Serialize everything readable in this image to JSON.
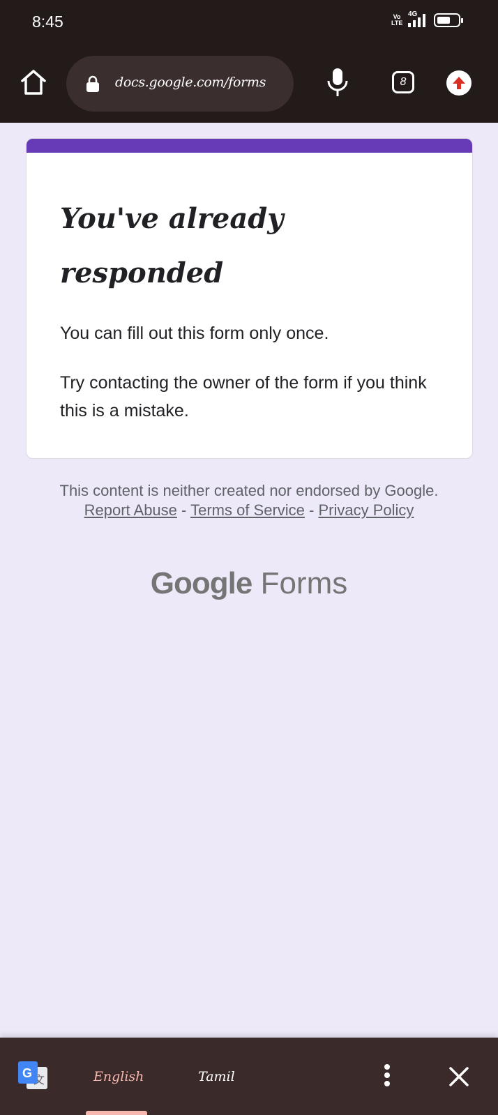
{
  "status_bar": {
    "time": "8:45",
    "volte_top": "Vo",
    "volte_bottom": "LTE",
    "network": "4G"
  },
  "browser": {
    "url": "docs.google.com/forms",
    "tab_count": "8"
  },
  "form": {
    "accent_color": "#673ab7",
    "title": "You've already responded",
    "message_once": "You can fill out this form only once.",
    "message_contact": "Try contacting the owner of the form if you think this is a mistake."
  },
  "footer": {
    "disclaimer": "This content is neither created nor endorsed by Google.",
    "report_abuse": "Report Abuse",
    "terms": "Terms of Service",
    "privacy": "Privacy Policy",
    "separator": "-",
    "logo_google": "Google",
    "logo_forms": "Forms"
  },
  "translate_bar": {
    "source_language": "English",
    "target_language": "Tamil",
    "icon": "google-translate-icon"
  }
}
